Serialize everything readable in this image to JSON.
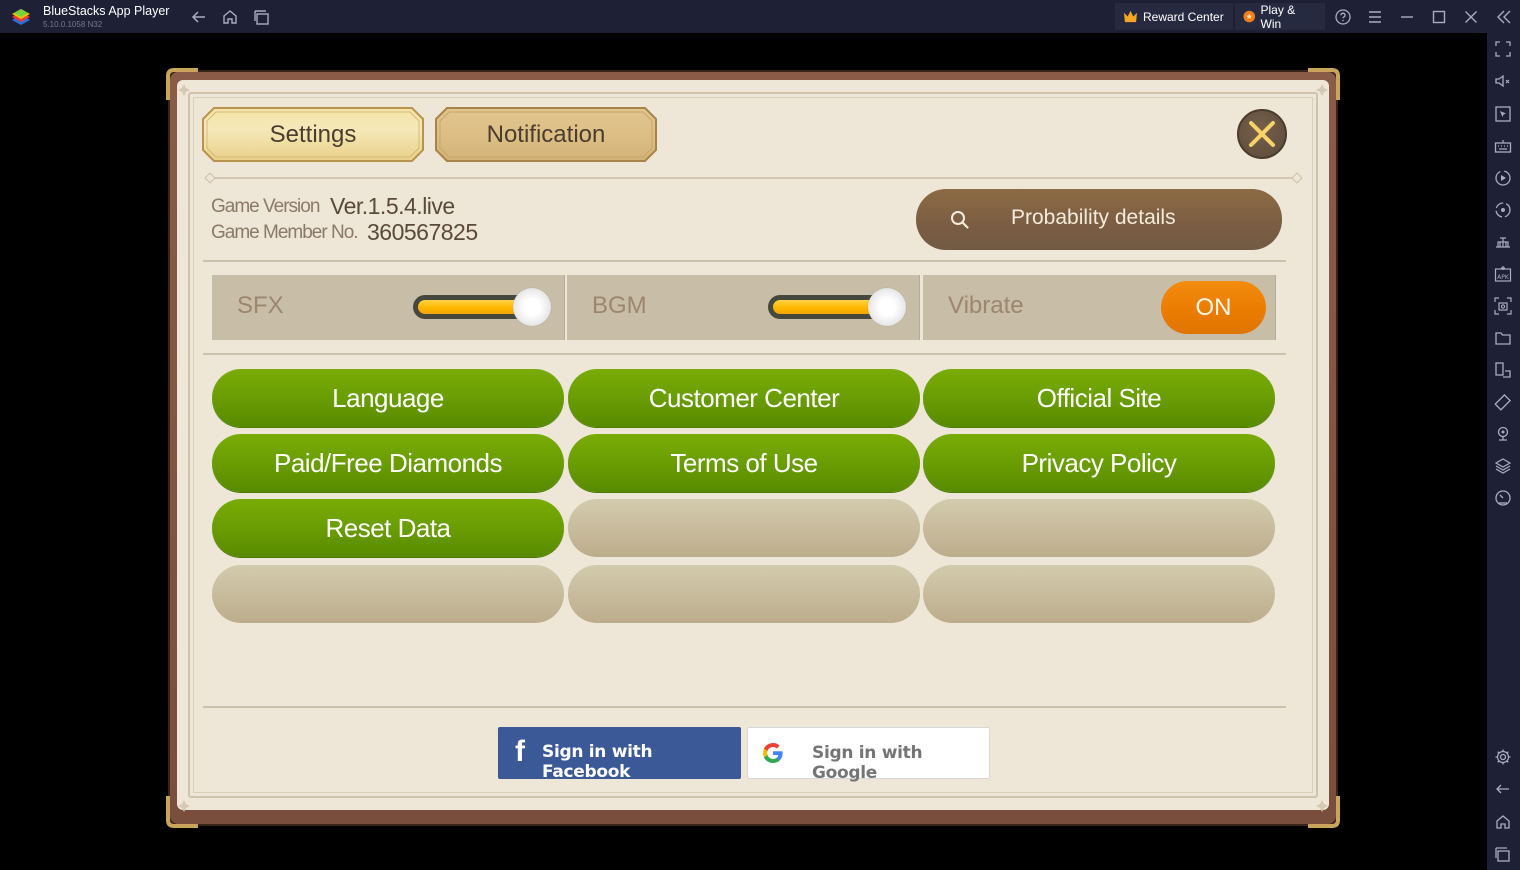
{
  "titlebar": {
    "app_name": "BlueStacks App Player",
    "version": "5.10.0.1058  N32",
    "reward_center": "Reward Center",
    "play_win": "Play & Win"
  },
  "sidebar": {
    "icons": [
      "fullscreen-icon",
      "volume-mute-icon",
      "cursor-icon",
      "keyboard-icon",
      "macro-play-icon",
      "sync-icon",
      "build-icon",
      "apk-icon",
      "screenshot-icon",
      "folder-icon",
      "multi-instance-icon",
      "rotate-icon",
      "location-icon",
      "layers-icon",
      "performance-icon"
    ],
    "bottom_icons": [
      "settings-icon",
      "back-icon",
      "home-icon",
      "recent-apps-icon"
    ]
  },
  "game": {
    "tabs": [
      {
        "label": "Settings",
        "active": true
      },
      {
        "label": "Notification",
        "active": false
      }
    ],
    "info": {
      "version_label": "Game Version",
      "version_value": "Ver.1.5.4.live",
      "member_label": "Game Member No.",
      "member_value": "360567825"
    },
    "probability_button": "Probability details",
    "sound": {
      "sfx_label": "SFX",
      "sfx_level": 1.0,
      "bgm_label": "BGM",
      "bgm_level": 1.0,
      "vibrate_label": "Vibrate",
      "vibrate_state": "ON"
    },
    "options": [
      "Language",
      "Customer Center",
      "Official Site",
      "Paid/Free Diamonds",
      "Terms of Use",
      "Privacy Policy",
      "Reset Data",
      "",
      "",
      "",
      "",
      ""
    ],
    "signin": {
      "facebook": "Sign in with Facebook",
      "google": "Sign in with Google"
    }
  },
  "colors": {
    "titlebar_bg": "#1e2135",
    "paper_bg": "#eee6d6",
    "green_button": "#6a9d03",
    "toggle_on": "#e97b00",
    "probability_btn": "#7a5d42",
    "facebook_blue": "#3b5897"
  }
}
